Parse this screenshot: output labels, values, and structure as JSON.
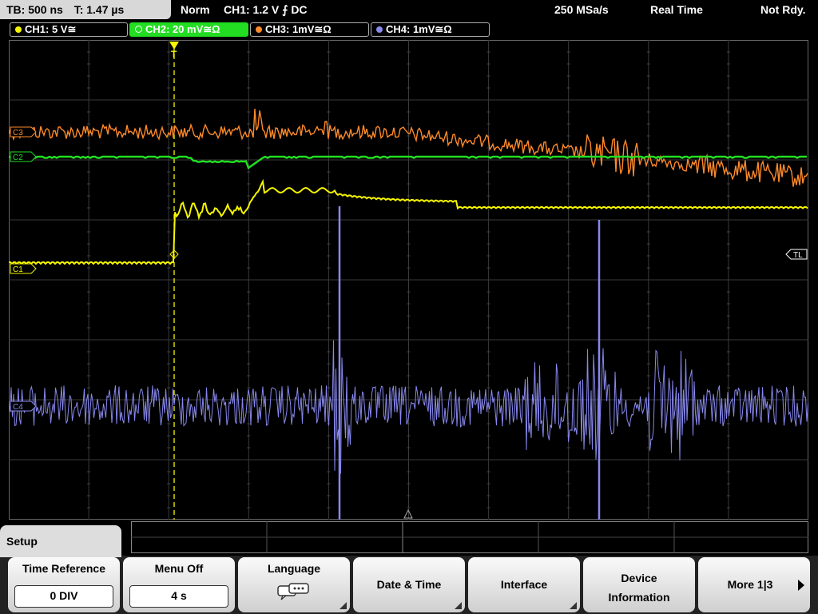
{
  "status": {
    "timebase": "TB: 500 ns",
    "trigger_time": "T: 1.47 µs",
    "mode": "Norm",
    "trigger_setting": "CH1: 1.2 V ⨍ DC",
    "sample_rate": "250 MSa/s",
    "acq_mode": "Real Time",
    "ready_state": "Not Rdy."
  },
  "channels": [
    {
      "label": "CH1: 5 V≅",
      "color": "#f5f500"
    },
    {
      "label": "CH2: 20 mV≅Ω",
      "color": "#22dd22"
    },
    {
      "label": "CH3: 1mV≅Ω",
      "color": "#ff8a2a"
    },
    {
      "label": "CH4: 1mV≅Ω",
      "color": "#8888ee"
    }
  ],
  "markers": {
    "c3": "C3",
    "c2": "C2",
    "c1": "C1",
    "c4": "C4",
    "tl": "TL",
    "trigger": "T"
  },
  "menu": {
    "title": "Setup",
    "softkeys": [
      {
        "label": "Time Reference",
        "value": "0 DIV"
      },
      {
        "label": "Menu Off",
        "value": "4 s"
      },
      {
        "label": "Language",
        "value": ""
      },
      {
        "label": "Date & Time",
        "value": ""
      },
      {
        "label": "Interface",
        "value": ""
      },
      {
        "label": "Device Information",
        "value": ""
      },
      {
        "label": "More 1|3",
        "value": ""
      }
    ]
  },
  "icons": {
    "language": "speech-bubble-icon",
    "more": "arrow-right-icon"
  }
}
